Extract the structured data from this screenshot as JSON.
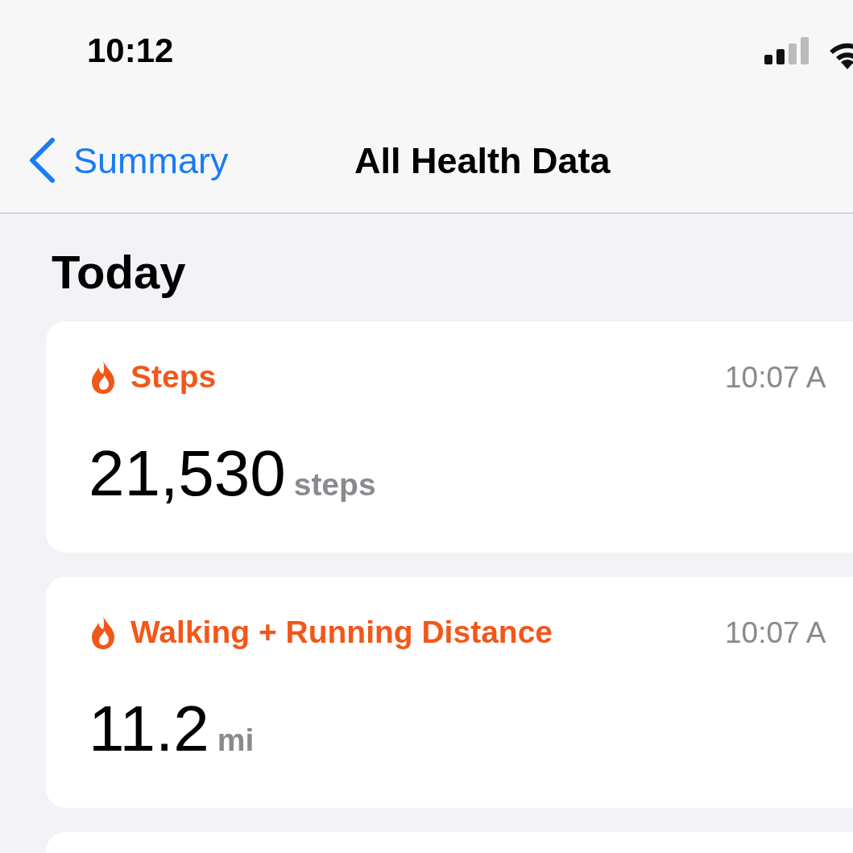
{
  "status_bar": {
    "time": "10:12"
  },
  "nav_bar": {
    "back_label": "Summary",
    "title": "All Health Data"
  },
  "section": {
    "title": "Today"
  },
  "cards": [
    {
      "kind": "metric",
      "label": "Steps",
      "time": "10:07 A",
      "value": "21,530",
      "unit": "steps"
    },
    {
      "kind": "metric",
      "label": "Walking + Running Distance",
      "time": "10:07 A",
      "value": "11.2",
      "unit": "mi"
    },
    {
      "kind": "empty"
    }
  ]
}
